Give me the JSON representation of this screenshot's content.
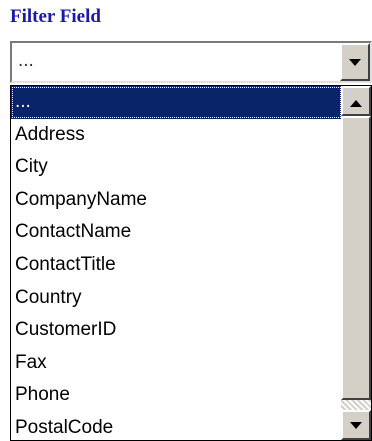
{
  "heading": "Filter Field",
  "select": {
    "value": "..."
  },
  "dropdown": {
    "options": [
      "...",
      "Address",
      "City",
      "CompanyName",
      "ContactName",
      "ContactTitle",
      "Country",
      "CustomerID",
      "Fax",
      "Phone",
      "PostalCode"
    ],
    "selected_index": 0
  },
  "colors": {
    "heading": "#1a1aa6",
    "selection_bg": "#0a246a",
    "selection_text": "#ffffff"
  }
}
